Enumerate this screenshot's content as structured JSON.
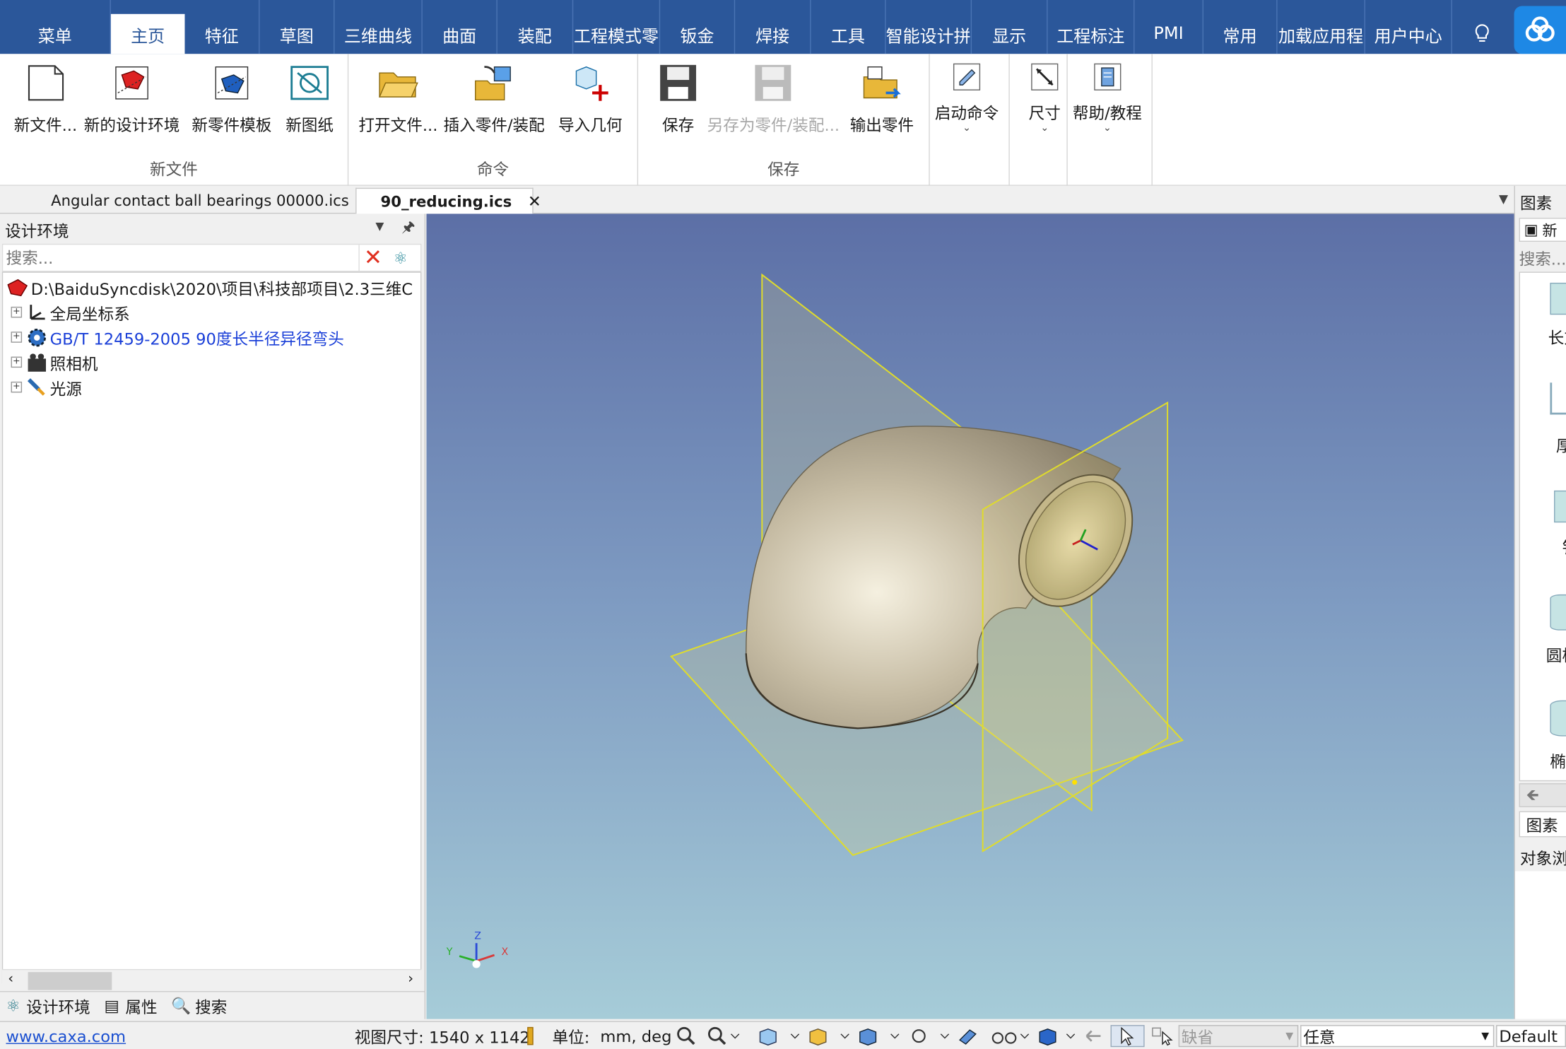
{
  "menu": {
    "tabs": [
      "菜单",
      "主页",
      "特征",
      "草图",
      "三维曲线",
      "曲面",
      "装配",
      "工程模式零",
      "钣金",
      "焊接",
      "工具",
      "智能设计拼",
      "显示",
      "工程标注",
      "PMI",
      "常用",
      "加载应用程",
      "用户中心"
    ],
    "active_index": 1
  },
  "ribbon": {
    "groups": {
      "new_file": "新文件",
      "command": "命令",
      "save": "保存"
    },
    "buttons": {
      "new_file": "新文件...",
      "new_design_env": "新的设计环境",
      "new_part_template": "新零件模板",
      "new_drawing": "新图纸",
      "open_file": "打开文件...",
      "insert_part": "插入零件/装配",
      "import_geometry": "导入几何",
      "save": "保存",
      "save_as": "另存为零件/装配...",
      "export_part": "输出零件",
      "start_command": "启动命令",
      "dimension": "尺寸",
      "help": "帮助/教程"
    }
  },
  "doc_tabs": [
    "Angular contact ball bearings 00000.ics",
    "90_reducing.ics"
  ],
  "left_panel": {
    "title": "设计环境",
    "search_placeholder": "搜索...",
    "tree": {
      "root": "D:\\BaiduSyncdisk\\2020\\项目\\科技部项目\\2.3三维C",
      "items": [
        "全局坐标系",
        "GB/T 12459-2005 90度长半径异径弯头",
        "照相机",
        "光源"
      ]
    },
    "bottom_tabs": [
      "设计环境",
      "属性",
      "搜索"
    ]
  },
  "right_panel": {
    "title": "图素",
    "new_label": "新",
    "search_placeholder": "搜索...",
    "items": [
      "长方",
      "厚",
      "钅",
      "圆柱",
      "椭圆"
    ],
    "footer_title": "图素",
    "object_label": "对象浏"
  },
  "axis_labels": {
    "x": "X",
    "y": "Y",
    "z": "Z"
  },
  "status": {
    "link": "www.caxa.com",
    "view_size": "视图尺寸: 1540 x 1142",
    "unit_label": "单位:",
    "unit_value": "mm, deg",
    "combo1": "缺省",
    "combo2": "任意",
    "combo3": "Default"
  }
}
